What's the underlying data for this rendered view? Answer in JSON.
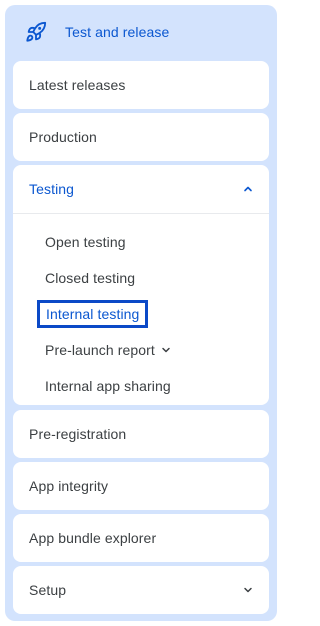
{
  "header": {
    "title": "Test and release",
    "icon": "rocket-icon",
    "accent": "#0b57d0"
  },
  "nav": {
    "latest_releases": "Latest releases",
    "production": "Production",
    "testing": {
      "label": "Testing",
      "expanded": true,
      "items": {
        "open_testing": "Open testing",
        "closed_testing": "Closed testing",
        "internal_testing": "Internal testing",
        "pre_launch_report": "Pre-launch report",
        "internal_app_sharing": "Internal app sharing"
      }
    },
    "pre_registration": "Pre-registration",
    "app_integrity": "App integrity",
    "app_bundle_explorer": "App bundle explorer",
    "setup": "Setup"
  }
}
